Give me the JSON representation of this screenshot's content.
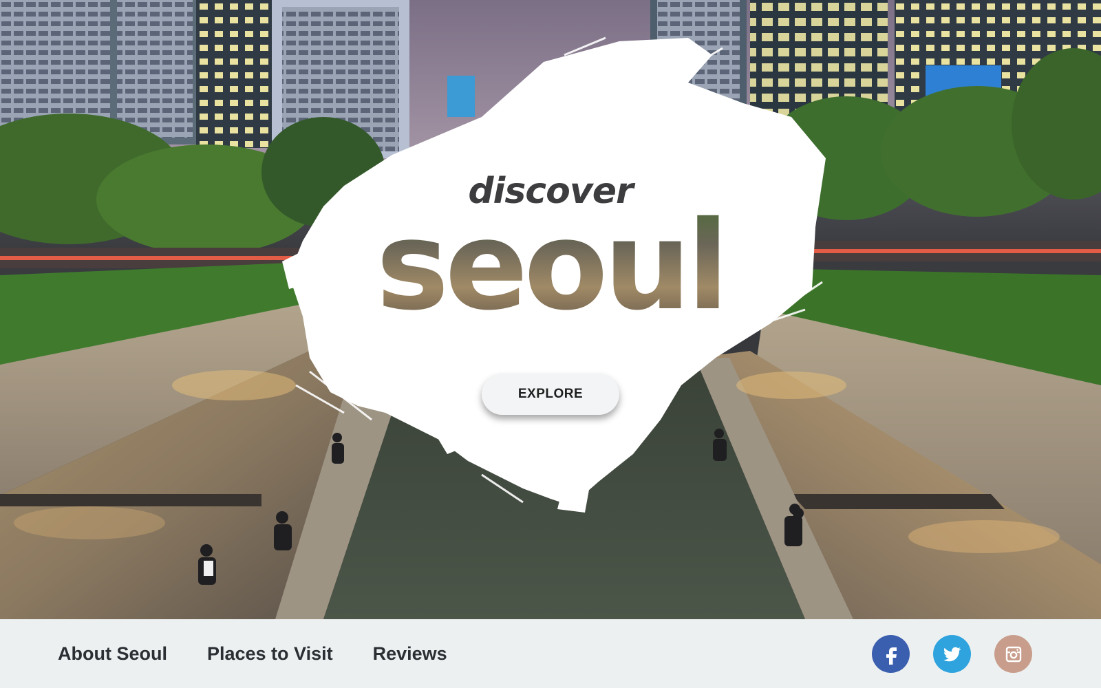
{
  "hero": {
    "tagline": "discover",
    "city": "seoul",
    "explore_label": "EXPLORE"
  },
  "nav": {
    "items": [
      {
        "label": "About Seoul"
      },
      {
        "label": "Places to Visit"
      },
      {
        "label": "Reviews"
      }
    ]
  },
  "social": [
    {
      "name": "facebook-icon",
      "color": "#3b5faf"
    },
    {
      "name": "twitter-icon",
      "color": "#2ea3dd"
    },
    {
      "name": "instagram-icon",
      "color": "#c89d8b"
    }
  ],
  "colors": {
    "footer_bg": "#edf0f1",
    "nav_text": "#2b2f33",
    "brush": "#ffffff"
  }
}
